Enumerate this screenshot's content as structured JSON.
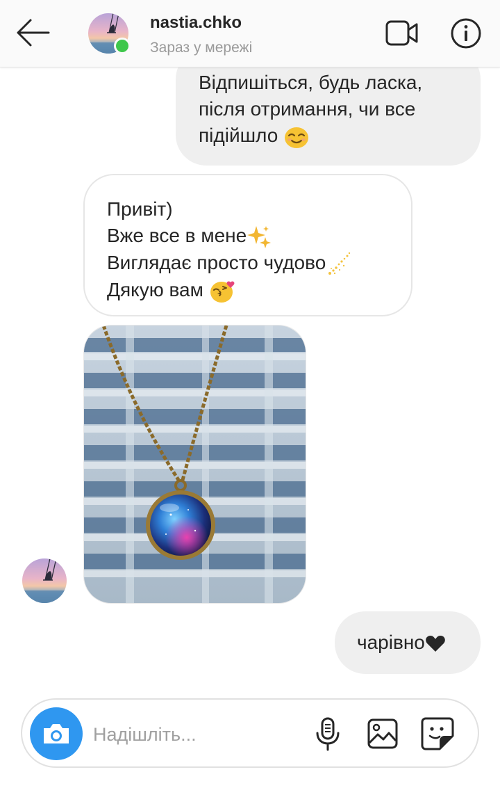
{
  "header": {
    "username": "nastia.chko",
    "status": "Зараз у мережі",
    "icons": {
      "back": "arrow-left-icon",
      "video": "video-call-icon",
      "info": "info-icon"
    },
    "online_color": "#3ec74b"
  },
  "messages": [
    {
      "direction": "outgoing",
      "lines": [
        "Відпишіться, будь ласка,",
        "після отримання, чи все",
        "підійшло"
      ],
      "trailing_emoji": "smiling-face-emoji"
    },
    {
      "direction": "incoming",
      "lines": [
        "Привіт)",
        "Вже все в мене",
        "Виглядає просто чудово",
        " Дякую вам"
      ],
      "emojis": [
        "sparkles-emoji",
        "shooting-star-emoji",
        "kissing-face-emoji"
      ]
    },
    {
      "direction": "incoming",
      "type": "photo",
      "subject": "galaxy-pendant-necklace-photo"
    },
    {
      "direction": "outgoing",
      "text": "чарівно",
      "trailing_emoji": "black-heart-emoji"
    }
  ],
  "composer": {
    "placeholder": "Надішліть...",
    "icons": [
      "camera-icon",
      "microphone-icon",
      "gallery-icon",
      "sticker-icon"
    ],
    "camera_color": "#2f97f0"
  },
  "colors": {
    "outgoing_bubble": "#efefef",
    "incoming_border": "#e6e6e6",
    "text": "#262626",
    "secondary_text": "#9a9a9a"
  }
}
